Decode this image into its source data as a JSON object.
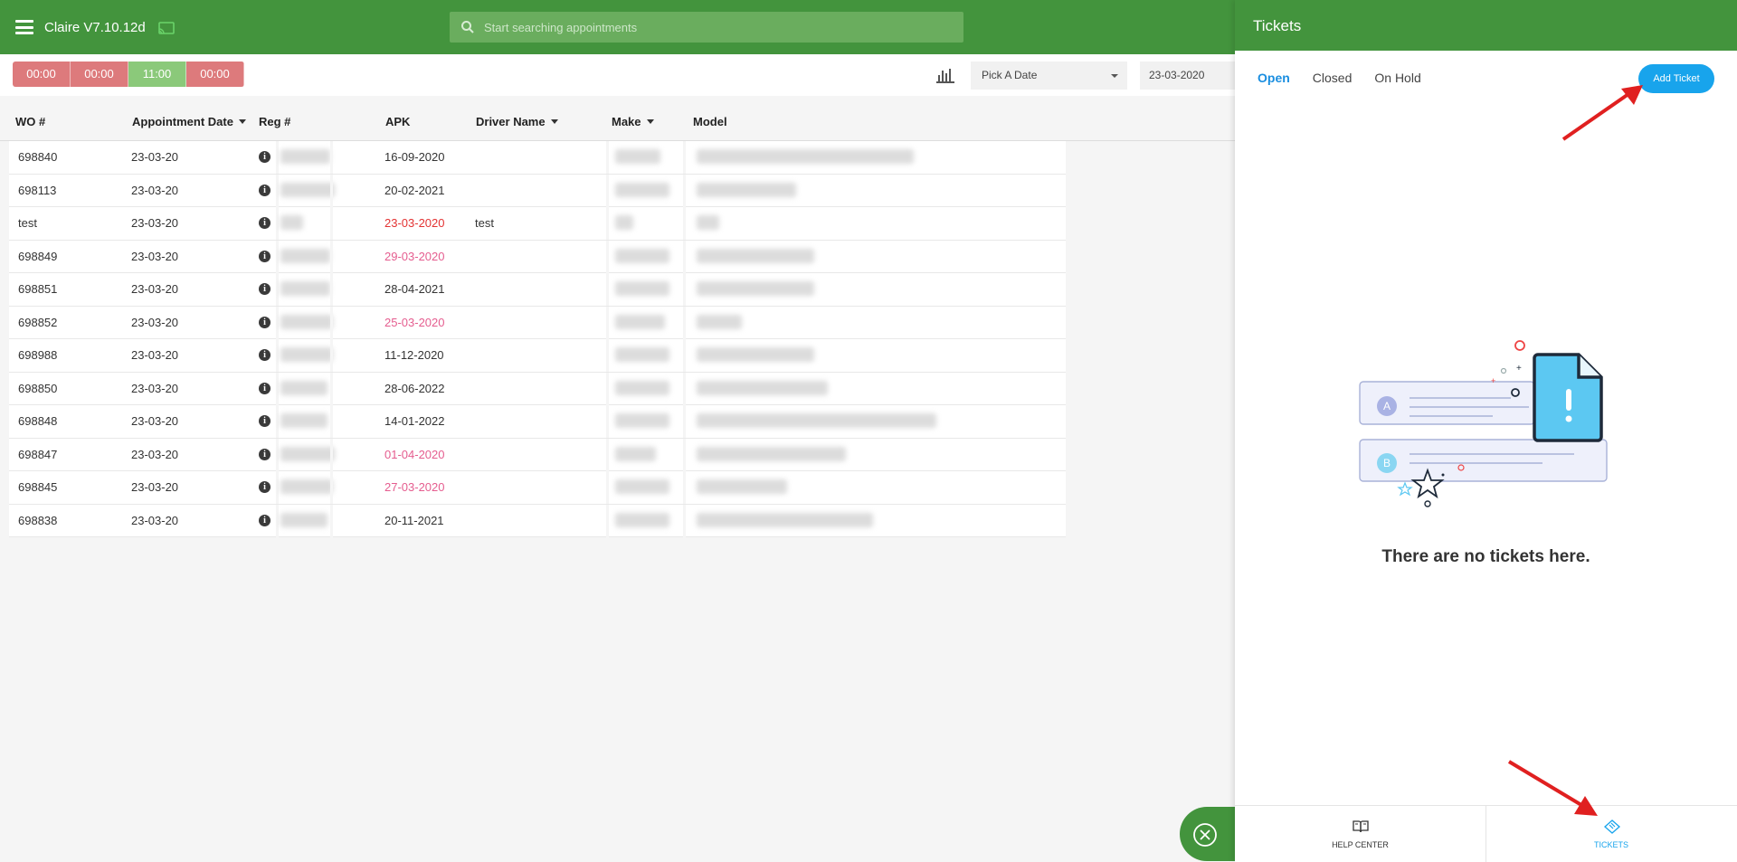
{
  "header": {
    "app_title": "Claire V7.10.12d",
    "search_placeholder": "Start searching appointments"
  },
  "toolbar": {
    "timers": [
      {
        "label": "00:00",
        "state": "red"
      },
      {
        "label": "00:00",
        "state": "red"
      },
      {
        "label": "11:00",
        "state": "green"
      },
      {
        "label": "00:00",
        "state": "red"
      }
    ],
    "date_picker_label": "Pick A Date",
    "date_value": "23-03-2020"
  },
  "table": {
    "columns": {
      "wo": "WO #",
      "appointment_date": "Appointment Date",
      "reg": "Reg #",
      "apk": "APK",
      "driver_name": "Driver Name",
      "make": "Make",
      "model": "Model"
    },
    "rows": [
      {
        "wo": "698840",
        "date": "23-03-20",
        "apk": "16-09-2020",
        "apk_status": "normal",
        "driver": ""
      },
      {
        "wo": "698113",
        "date": "23-03-20",
        "apk": "20-02-2021",
        "apk_status": "normal",
        "driver": ""
      },
      {
        "wo": "test",
        "date": "23-03-20",
        "apk": "23-03-2020",
        "apk_status": "expired",
        "driver": "test"
      },
      {
        "wo": "698849",
        "date": "23-03-20",
        "apk": "29-03-2020",
        "apk_status": "soon",
        "driver": ""
      },
      {
        "wo": "698851",
        "date": "23-03-20",
        "apk": "28-04-2021",
        "apk_status": "normal",
        "driver": ""
      },
      {
        "wo": "698852",
        "date": "23-03-20",
        "apk": "25-03-2020",
        "apk_status": "soon",
        "driver": ""
      },
      {
        "wo": "698988",
        "date": "23-03-20",
        "apk": "11-12-2020",
        "apk_status": "normal",
        "driver": ""
      },
      {
        "wo": "698850",
        "date": "23-03-20",
        "apk": "28-06-2022",
        "apk_status": "normal",
        "driver": ""
      },
      {
        "wo": "698848",
        "date": "23-03-20",
        "apk": "14-01-2022",
        "apk_status": "normal",
        "driver": ""
      },
      {
        "wo": "698847",
        "date": "23-03-20",
        "apk": "01-04-2020",
        "apk_status": "soon",
        "driver": ""
      },
      {
        "wo": "698845",
        "date": "23-03-20",
        "apk": "27-03-2020",
        "apk_status": "soon",
        "driver": ""
      },
      {
        "wo": "698838",
        "date": "23-03-20",
        "apk": "20-11-2021",
        "apk_status": "normal",
        "driver": ""
      }
    ]
  },
  "panel": {
    "title": "Tickets",
    "tabs": [
      {
        "label": "Open",
        "active": true
      },
      {
        "label": "Closed",
        "active": false
      },
      {
        "label": "On Hold",
        "active": false
      }
    ],
    "add_ticket_label": "Add Ticket",
    "empty_message": "There are no tickets here.",
    "illustration_letters": [
      "A",
      "B"
    ],
    "footer": [
      {
        "label": "HELP CENTER",
        "icon": "book-icon",
        "active": false
      },
      {
        "label": "TICKETS",
        "icon": "ticket-icon",
        "active": true
      }
    ]
  },
  "colors": {
    "brand_green": "#43943d",
    "accent_blue": "#18a4ec",
    "timer_red": "#dd7a7c",
    "timer_green": "#8bc97a",
    "apk_expired": "#e33333",
    "apk_soon": "#e55d8f",
    "annotation_arrow": "#e02020"
  }
}
